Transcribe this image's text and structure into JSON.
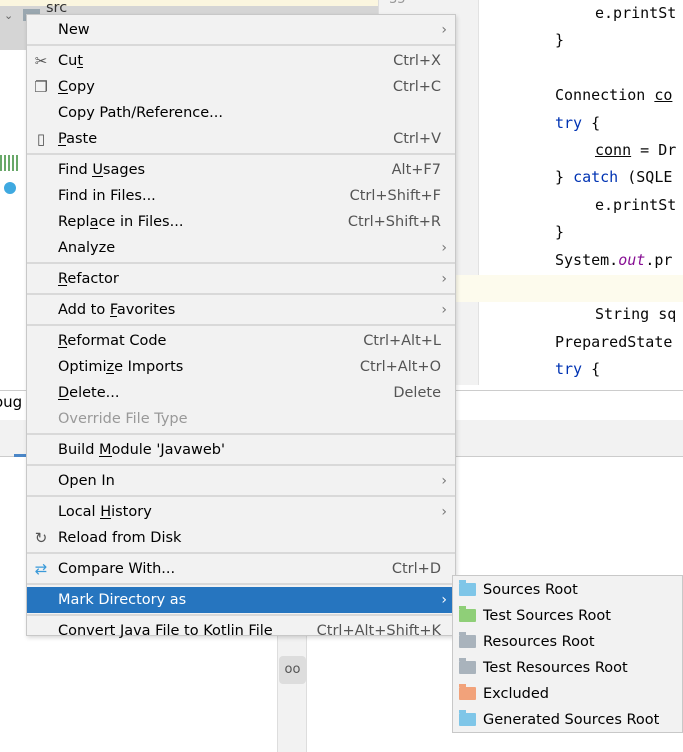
{
  "project": {
    "folder_name": "src",
    "line_number": "35",
    "side_label": "oug"
  },
  "editor": {
    "lines": [
      {
        "indent": 1,
        "parts": [
          {
            "t": "e.printSt"
          }
        ]
      },
      {
        "indent": 0,
        "parts": [
          {
            "t": "}"
          }
        ]
      },
      {
        "indent": 0,
        "parts": []
      },
      {
        "indent": 0,
        "parts": [
          {
            "t": "Connection "
          },
          {
            "t": "co",
            "c": "ul"
          }
        ]
      },
      {
        "indent": 0,
        "parts": [
          {
            "t": "try",
            "c": "kw"
          },
          {
            "t": " {"
          }
        ]
      },
      {
        "indent": 1,
        "parts": [
          {
            "t": "conn",
            "c": "ul"
          },
          {
            "t": " = Dr"
          }
        ]
      },
      {
        "indent": 0,
        "parts": [
          {
            "t": "} "
          },
          {
            "t": "catch",
            "c": "kw"
          },
          {
            "t": " (SQLE"
          }
        ]
      },
      {
        "indent": 1,
        "parts": [
          {
            "t": "e.printSt"
          }
        ]
      },
      {
        "indent": 0,
        "parts": [
          {
            "t": "}"
          }
        ]
      },
      {
        "indent": 0,
        "parts": [
          {
            "t": "System."
          },
          {
            "t": "out",
            "c": "it"
          },
          {
            "t": ".pr"
          }
        ]
      },
      {
        "indent": 0,
        "parts": []
      },
      {
        "indent": 1,
        "parts": [
          {
            "t": "String sq"
          }
        ]
      },
      {
        "indent": 0,
        "parts": [
          {
            "t": "PreparedState"
          }
        ]
      },
      {
        "indent": 0,
        "parts": [
          {
            "t": "try",
            "c": "kw"
          },
          {
            "t": " {"
          }
        ]
      }
    ]
  },
  "context_menu": {
    "items": [
      {
        "label": "New",
        "submenu": true
      },
      {
        "sep": true
      },
      {
        "label": "Cut",
        "mn": 2,
        "shortcut": "Ctrl+X",
        "icon": "scissors"
      },
      {
        "label": "Copy",
        "mn": 0,
        "shortcut": "Ctrl+C",
        "icon": "copy"
      },
      {
        "label": "Copy Path/Reference..."
      },
      {
        "label": "Paste",
        "mn": 0,
        "shortcut": "Ctrl+V",
        "icon": "clipboard"
      },
      {
        "sep": true
      },
      {
        "label": "Find Usages",
        "mn": 5,
        "shortcut": "Alt+F7"
      },
      {
        "label": "Find in Files...",
        "shortcut": "Ctrl+Shift+F"
      },
      {
        "label": "Replace in Files...",
        "mn": 4,
        "shortcut": "Ctrl+Shift+R"
      },
      {
        "label": "Analyze",
        "submenu": true
      },
      {
        "sep": true
      },
      {
        "label": "Refactor",
        "mn": 0,
        "submenu": true
      },
      {
        "sep": true
      },
      {
        "label": "Add to Favorites",
        "mn": 7,
        "submenu": true
      },
      {
        "sep": true
      },
      {
        "label": "Reformat Code",
        "mn": 0,
        "shortcut": "Ctrl+Alt+L"
      },
      {
        "label": "Optimize Imports",
        "mn": 6,
        "shortcut": "Ctrl+Alt+O"
      },
      {
        "label": "Delete...",
        "mn": 0,
        "shortcut": "Delete"
      },
      {
        "label": "Override File Type",
        "disabled": true
      },
      {
        "sep": true
      },
      {
        "label": "Build Module 'Javaweb'",
        "mn": 6
      },
      {
        "sep": true
      },
      {
        "label": "Open In",
        "submenu": true
      },
      {
        "sep": true
      },
      {
        "label": "Local History",
        "mn": 6,
        "submenu": true
      },
      {
        "label": "Reload from Disk",
        "icon": "reload"
      },
      {
        "sep": true
      },
      {
        "label": "Compare With...",
        "shortcut": "Ctrl+D",
        "icon": "compare"
      },
      {
        "sep": true
      },
      {
        "label": "Mark Directory as",
        "submenu": true,
        "highlighted": true
      },
      {
        "sep": true
      },
      {
        "label": "Convert Java File to Kotlin File",
        "shortcut": "Ctrl+Alt+Shift+K"
      }
    ]
  },
  "submenu": {
    "items": [
      {
        "label": "Sources Root",
        "color": "#7fc6e8"
      },
      {
        "label": "Test Sources Root",
        "color": "#8fcf78"
      },
      {
        "label": "Resources Root",
        "color": "#a9b3bc"
      },
      {
        "label": "Test Resources Root",
        "color": "#a9b3bc"
      },
      {
        "label": "Excluded",
        "color": "#f2a27a"
      },
      {
        "label": "Generated Sources Root",
        "color": "#7fc6e8"
      }
    ]
  },
  "colors": {
    "highlight": "#2675bf",
    "menu_bg": "#f2f2f2"
  }
}
